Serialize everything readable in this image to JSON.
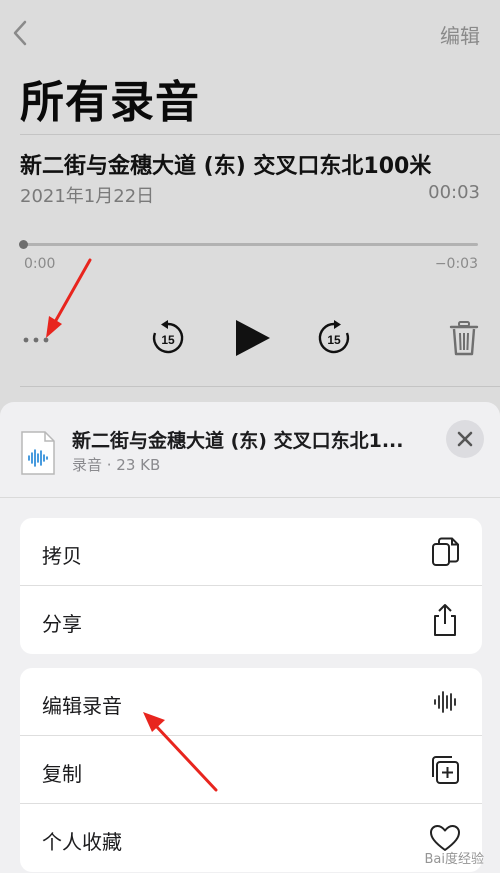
{
  "header": {
    "edit_label": "编辑",
    "title": "所有录音"
  },
  "recording": {
    "title": "新二街与金穗大道 (东) 交叉口东北100米",
    "date": "2021年1月22日",
    "duration": "00:03",
    "time_elapsed": "0:00",
    "time_remaining": "−0:03",
    "progress": 0,
    "skip_seconds": "15"
  },
  "sheet": {
    "file_name": "新二街与金穗大道 (东) 交叉口东北1...",
    "file_meta": "录音 · 23 KB",
    "group1": [
      {
        "label": "拷贝",
        "icon": "copy-icon"
      },
      {
        "label": "分享",
        "icon": "share-icon"
      }
    ],
    "group2": [
      {
        "label": "编辑录音",
        "icon": "waveform-icon"
      },
      {
        "label": "复制",
        "icon": "duplicate-icon"
      },
      {
        "label": "个人收藏",
        "icon": "heart-icon"
      }
    ]
  },
  "watermark": "Bai度经验",
  "colors": {
    "annotation_arrow": "#e8251e",
    "accent_waveform": "#1a82d6"
  }
}
